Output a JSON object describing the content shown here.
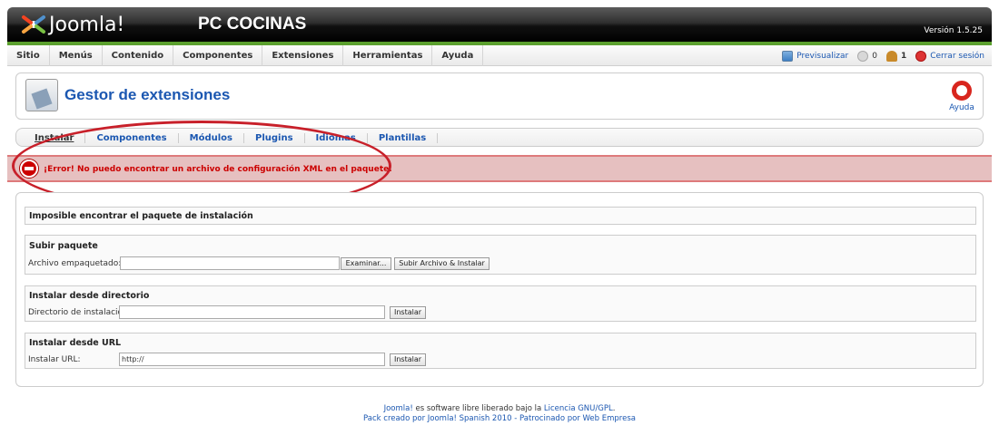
{
  "header": {
    "logo_text": "Joomla!",
    "site_name": "PC COCINAS",
    "version": "Versión 1.5.25"
  },
  "menu": {
    "items": [
      "Sitio",
      "Menús",
      "Contenido",
      "Componentes",
      "Extensiones",
      "Herramientas",
      "Ayuda"
    ]
  },
  "status": {
    "preview": "Previsualizar",
    "messages_count": "0",
    "users_count": "1",
    "logout": "Cerrar sesión"
  },
  "toolbar": {
    "title": "Gestor de extensiones",
    "help": "Ayuda"
  },
  "submenu": {
    "items": [
      "Instalar",
      "Componentes",
      "Módulos",
      "Plugins",
      "Idiomas",
      "Plantillas"
    ],
    "active_index": 0
  },
  "error": {
    "message": "¡Error! No puedo encontrar un archivo de configuración XML en el paquete."
  },
  "sections": {
    "notice": "Imposible encontrar el paquete de instalación",
    "upload": {
      "title": "Subir paquete",
      "label": "Archivo empaquetado:",
      "browse_button": "Examinar...",
      "submit_button": "Subir Archivo & Instalar"
    },
    "directory": {
      "title": "Instalar desde directorio",
      "label": "Directorio de instalación:",
      "value": "",
      "button": "Instalar"
    },
    "url": {
      "title": "Instalar desde URL",
      "label": "Instalar URL:",
      "value": "http://",
      "button": "Instalar"
    }
  },
  "footer": {
    "line1_link1": "Joomla!",
    "line1_text": " es software libre liberado bajo la ",
    "line1_link2": "Licencia GNU/GPL",
    "line1_end": ".",
    "line2": "Pack creado por Joomla! Spanish 2010 - Patrocinado por Web Empresa"
  },
  "colors": {
    "accent_link": "#1b57b1",
    "header_green": "#5ba02e",
    "error_red": "#cc0000",
    "error_bg": "#e6c0c0",
    "annotation_red": "#c8202a"
  }
}
